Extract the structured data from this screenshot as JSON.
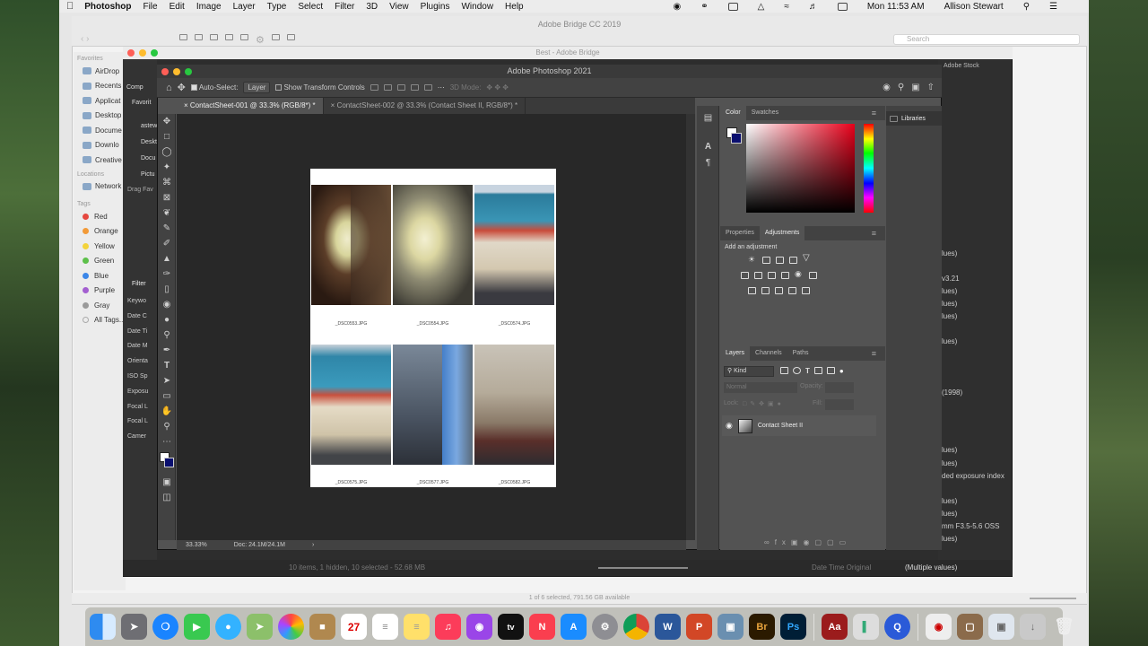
{
  "menubar": {
    "app": "Photoshop",
    "menus": [
      "File",
      "Edit",
      "Image",
      "Layer",
      "Type",
      "Select",
      "Filter",
      "3D",
      "View",
      "Plugins",
      "Window",
      "Help"
    ],
    "clock": "Mon 11:53 AM",
    "user": "Allison Stewart"
  },
  "bridge_cc": {
    "title": "Adobe Bridge CC 2019",
    "search_placeholder": "Search",
    "status": "1 of 6 selected, 791.56 GB available"
  },
  "finder_sidebar": {
    "favorites_label": "Favorites",
    "favorites": [
      "AirDrop",
      "Recents",
      "Applicat",
      "Desktop",
      "Docume",
      "Downlo",
      "Creative"
    ],
    "locations_label": "Locations",
    "locations": [
      "Network"
    ],
    "tags_label": "Tags",
    "tags": [
      {
        "name": "Red",
        "color": "#e5473f"
      },
      {
        "name": "Orange",
        "color": "#f29a38"
      },
      {
        "name": "Yellow",
        "color": "#f3d33b"
      },
      {
        "name": "Green",
        "color": "#5dc04a"
      },
      {
        "name": "Blue",
        "color": "#3b86e8"
      },
      {
        "name": "Purple",
        "color": "#a35fd0"
      },
      {
        "name": "Gray",
        "color": "#9a9a9a"
      },
      {
        "name": "All Tags...",
        "color": ""
      }
    ]
  },
  "bridge_best": {
    "title": "Best - Adobe Bridge",
    "stock": "Adobe Stock",
    "left_favorites": "Favorit",
    "left_items": [
      "Comp",
      "astew",
      "Deskt",
      "Docu",
      "Pictu"
    ],
    "drag_favorites": "Drag Fav",
    "filter_label": "Filter",
    "filter_items": [
      "Keywo",
      "Date C",
      "Date Ti",
      "Date M",
      "Orienta",
      "ISO Sp",
      "Exposu",
      "Focal L",
      "Focal L",
      "Camer"
    ],
    "bottom_status": "10 items, 1 hidden, 10 selected - 52.68 MB",
    "metadata_values": [
      "lues)",
      "v3.21",
      "lues)",
      "lues)",
      "lues)",
      "lues)",
      "(1998)",
      "lues)",
      "lues)",
      "ded exposure index",
      "lues)",
      "lues)",
      "mm F3.5-5.6 OSS",
      "lues)"
    ],
    "meta_bottom_key": "Date Time Original",
    "meta_bottom_val": "(Multiple values)"
  },
  "photoshop": {
    "title": "Adobe Photoshop 2021",
    "options": {
      "auto_select": "Auto-Select:",
      "layer": "Layer",
      "show_transform": "Show Transform Controls",
      "mode_3d": "3D Mode:"
    },
    "tabs": [
      {
        "label": "ContactSheet-001 @ 33.3% (RGB/8*) *",
        "active": true
      },
      {
        "label": "ContactSheet-002 @ 33.3% (Contact Sheet II, RGB/8*) *",
        "active": false
      }
    ],
    "status": {
      "zoom": "33.33%",
      "doc": "Doc: 24.1M/24.1M"
    },
    "captions": [
      "_DSC0553.JPG",
      "_DSC0554.JPG",
      "_DSC0574.JPG",
      "_DSC0575.JPG",
      "_DSC0577.JPG",
      "_DSC0582.JPG"
    ],
    "color_panel": {
      "tabs": [
        "Color",
        "Swatches"
      ]
    },
    "adjust_panel": {
      "tabs": [
        "Properties",
        "Adjustments"
      ],
      "hint": "Add an adjustment"
    },
    "layers_panel": {
      "tabs": [
        "Layers",
        "Channels",
        "Paths"
      ],
      "kind": "Kind",
      "blend": "Normal",
      "opacity_label": "Opacity:",
      "lock_label": "Lock:",
      "fill_label": "Fill:",
      "layer_name": "Contact Sheet II"
    },
    "libraries": "Libraries"
  }
}
